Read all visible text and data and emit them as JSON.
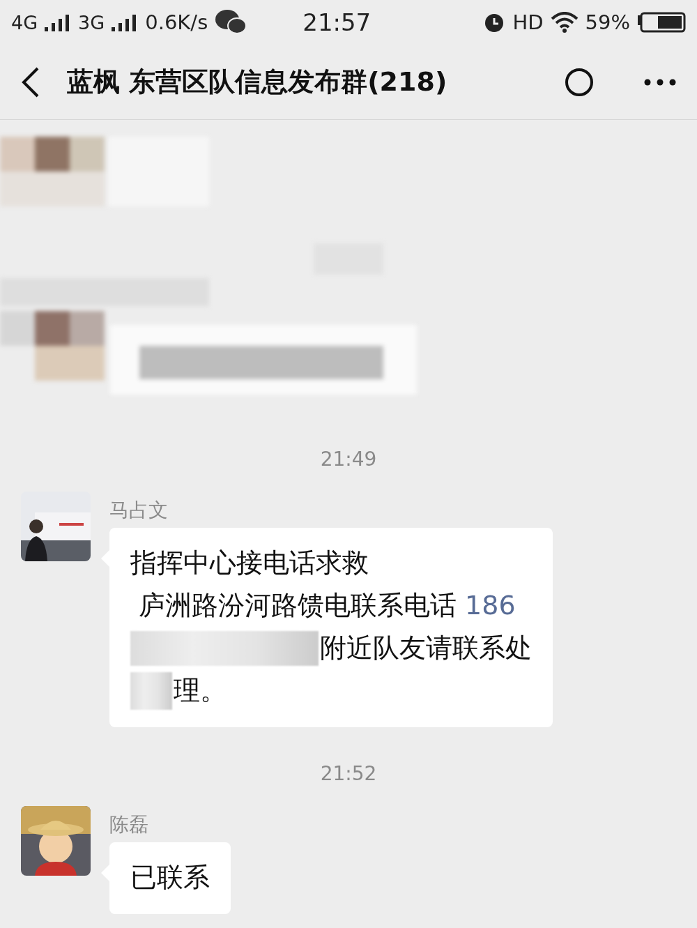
{
  "status_bar": {
    "network_1": "4G",
    "network_2": "3G",
    "speed": "0.6K/s",
    "time": "21:57",
    "hd": "HD",
    "battery": "59%"
  },
  "header": {
    "title": "蓝枫 东营区队信息发布群(218)"
  },
  "messages": [
    {
      "kind": "blurred"
    },
    {
      "kind": "time",
      "text": "21:49"
    },
    {
      "kind": "text",
      "sender": "马占文",
      "lines": [
        {
          "text": "指挥中心接电话求救",
          "redacted": false
        },
        {
          "text": " 庐洲路汾河路馈电联系电话",
          "phone": "186",
          "redacted": false
        },
        {
          "text": "附近队友请联系处",
          "redacted": true
        },
        {
          "text": "理。",
          "redacted": true
        }
      ]
    },
    {
      "kind": "time",
      "text": "21:52"
    },
    {
      "kind": "text",
      "sender": "陈磊",
      "lines": [
        {
          "text": "已联系",
          "redacted": false
        }
      ]
    }
  ]
}
